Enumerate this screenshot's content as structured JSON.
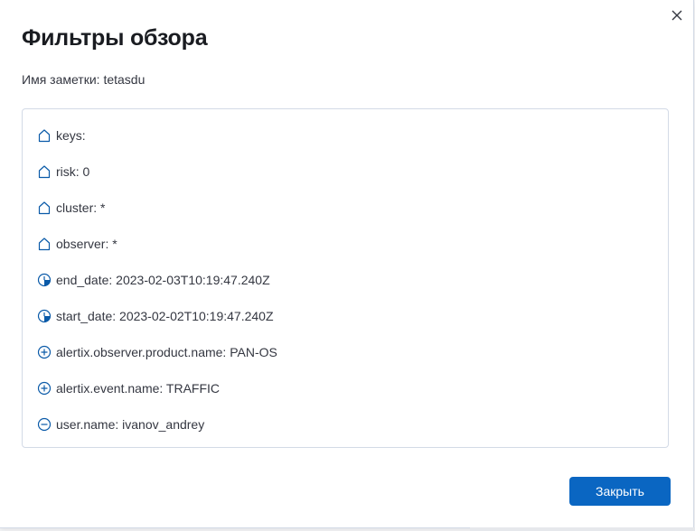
{
  "dialog": {
    "title": "Фильтры обзора",
    "note_label": "Имя заметки: tetasdu",
    "close_button_label": "Закрыть",
    "accent_color": "#0a66c2"
  },
  "filters": [
    {
      "icon": "home-icon",
      "text": "keys:"
    },
    {
      "icon": "home-icon",
      "text": "risk: 0"
    },
    {
      "icon": "home-icon",
      "text": "cluster: *"
    },
    {
      "icon": "home-icon",
      "text": "observer: *"
    },
    {
      "icon": "clock-icon",
      "text": "end_date: 2023-02-03T10:19:47.240Z"
    },
    {
      "icon": "clock-icon",
      "text": "start_date: 2023-02-02T10:19:47.240Z"
    },
    {
      "icon": "plus-circle-icon",
      "text": "alertix.observer.product.name: PAN-OS"
    },
    {
      "icon": "plus-circle-icon",
      "text": "alertix.event.name: TRAFFIC"
    },
    {
      "icon": "minus-circle-icon",
      "text": "user.name: ivanov_andrey"
    }
  ]
}
